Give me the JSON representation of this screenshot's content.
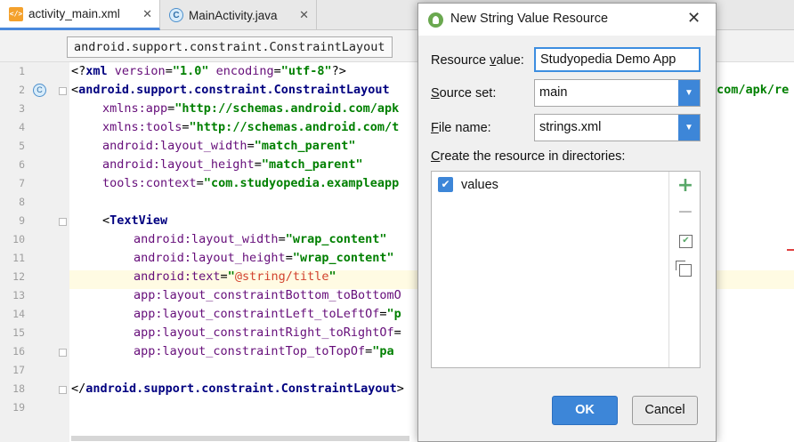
{
  "editor_tabs": [
    {
      "label": "activity_main.xml",
      "icon": "xml-file-icon",
      "active": true
    },
    {
      "label": "MainActivity.java",
      "icon": "java-class-icon",
      "active": false
    }
  ],
  "breadcrumb": "android.support.constraint.ConstraintLayout",
  "gutter": {
    "line_numbers": [
      "1",
      "2",
      "3",
      "4",
      "5",
      "6",
      "7",
      "8",
      "9",
      "10",
      "11",
      "12",
      "13",
      "14",
      "15",
      "16",
      "17",
      "18",
      "19"
    ],
    "class_badge": "C"
  },
  "code": {
    "l1_pre": "<?",
    "l1_tag": "xml",
    "l1_attr1": " version",
    "l1_eq1": "=",
    "l1_val1": "\"1.0\"",
    "l1_attr2": " encoding",
    "l1_eq2": "=",
    "l1_val2": "\"utf-8\"",
    "l1_end": "?>",
    "l2_pre": "<",
    "l2_tag": "android.support.constraint.ConstraintLayout",
    "l2_tail": "com/apk/re",
    "l3_attr": "xmlns:app",
    "l3_eq": "=",
    "l3_val": "\"http://schemas.android.com/apk",
    "l4_attr": "xmlns:tools",
    "l4_eq": "=",
    "l4_val": "\"http://schemas.android.com/t",
    "l5_attr": "android:layout_width",
    "l5_eq": "=",
    "l5_val": "\"match_parent\"",
    "l6_attr": "android:layout_height",
    "l6_eq": "=",
    "l6_val": "\"match_parent\"",
    "l7_attr": "tools:context",
    "l7_eq": "=",
    "l7_val": "\"com.studyopedia.exampleapp",
    "l9_pre": "<",
    "l9_tag": "TextView",
    "l10_attr": "android:layout_width",
    "l10_eq": "=",
    "l10_val": "\"wrap_content\"",
    "l11_attr": "android:layout_height",
    "l11_eq": "=",
    "l11_val": "\"wrap_content\"",
    "l12_attr": "android:text",
    "l12_eq": "=",
    "l12_q1": "\"",
    "l12_ref": "@string/title",
    "l12_q2": "\"",
    "l13_attr": "app:layout_constraintBottom_toBottomO",
    "l14_attr": "app:layout_constraintLeft_toLeftOf",
    "l14_eq": "=",
    "l14_val": "\"p",
    "l15_attr": "app:layout_constraintRight_toRightOf",
    "l15_eq": "=",
    "l16_attr": "app:layout_constraintTop_toTopOf",
    "l16_eq": "=",
    "l16_val": "\"pa",
    "l18_pre": "</",
    "l18_tag": "android.support.constraint.ConstraintLayout",
    "l18_end": ">"
  },
  "dialog": {
    "title": "New String Value Resource",
    "resource_value_label_underlined": "v",
    "resource_value_label_pre": "Resource ",
    "resource_value_label_post": "alue:",
    "resource_value": "Studyopedia Demo App",
    "source_set_label_underlined": "S",
    "source_set_label_post": "ource set:",
    "source_set_value": "main",
    "file_name_label_underlined": "F",
    "file_name_label_post": "ile name:",
    "file_name_value": "strings.xml",
    "directories_label_underlined": "C",
    "directories_label_post": "reate the resource in directories:",
    "directories": [
      {
        "label": "values",
        "checked": true
      }
    ],
    "ok_label": "OK",
    "cancel_label": "Cancel"
  },
  "colors": {
    "accent": "#3d86d8",
    "xml_tag": "#000080",
    "xml_attr": "#660e7a",
    "xml_value": "#008000",
    "string_ref": "#d2432f",
    "highlight_line": "#fffbe3"
  }
}
